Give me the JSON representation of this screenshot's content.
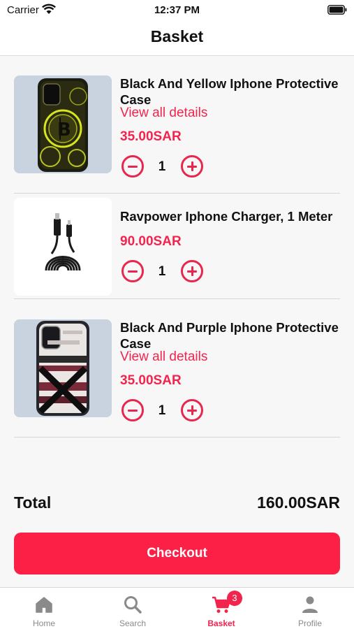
{
  "status_bar": {
    "carrier": "Carrier",
    "time": "12:37 PM"
  },
  "header": {
    "title": "Basket"
  },
  "items": [
    {
      "title": "Black And Yellow Iphone Protective Case",
      "details_link": "View all details",
      "price": "35.00SAR",
      "quantity": "1",
      "image_icon": "phone-case-bitcoin-image"
    },
    {
      "title": "Ravpower Iphone Charger, 1 Meter",
      "price": "90.00SAR",
      "quantity": "1",
      "image_icon": "usb-charger-cable-image"
    },
    {
      "title": "Black And Purple Iphone Protective Case",
      "details_link": "View all details",
      "price": "35.00SAR",
      "quantity": "1",
      "image_icon": "phone-case-stripes-image"
    }
  ],
  "summary": {
    "total_label": "Total",
    "total_value": "160.00SAR"
  },
  "checkout": {
    "label": "Checkout"
  },
  "tab_bar": {
    "tabs": [
      {
        "label": "Home",
        "icon": "home-icon"
      },
      {
        "label": "Search",
        "icon": "search-icon"
      },
      {
        "label": "Basket",
        "icon": "cart-icon",
        "badge": "3",
        "active": true
      },
      {
        "label": "Profile",
        "icon": "person-icon"
      }
    ]
  },
  "colors": {
    "accent": "#f2244e",
    "checkout_button": "#fc2046",
    "background": "#f7f7f7",
    "tab_inactive": "#8a8a8a"
  }
}
